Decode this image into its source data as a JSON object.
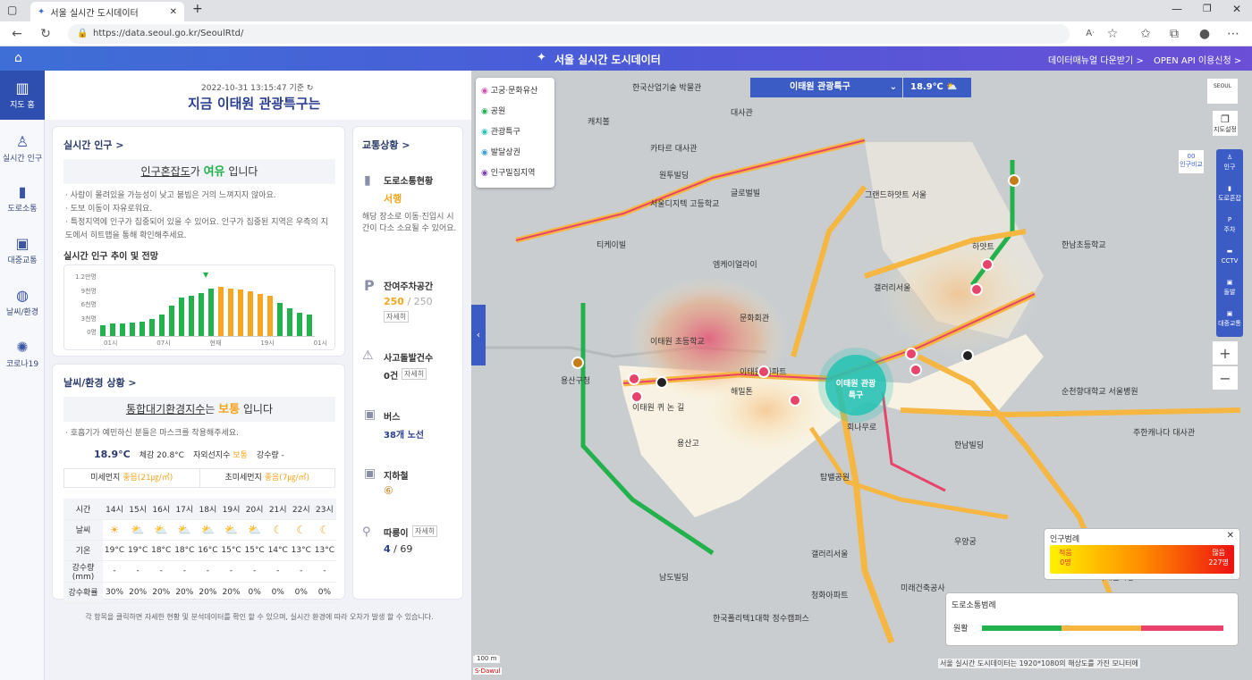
{
  "browser": {
    "tab_title": "서울 실시간 도시데이터",
    "url": "https://data.seoul.go.kr/SeoulRtd/"
  },
  "header": {
    "title": "서울 실시간 도시데이터",
    "link1": "데이터매뉴얼 다운받기 >",
    "link2": "OPEN API 이용신청 >"
  },
  "sidebar": {
    "items": [
      {
        "label": "지도 홈"
      },
      {
        "label": "실시간 인구"
      },
      {
        "label": "도로소통"
      },
      {
        "label": "대중교통"
      },
      {
        "label": "날씨/환경"
      },
      {
        "label": "코로나19"
      }
    ]
  },
  "panel": {
    "timestamp": "2022-10-31 13:15:47 기준",
    "heading": "지금 이태원 관광특구는",
    "pop": {
      "title": "실시간 인구 >",
      "status_pre": "인구혼잡도",
      "status_mid": "가 ",
      "status_val": "여유",
      "status_post": " 입니다",
      "desc1": "· 사람이 몰려있을 가능성이 낮고 붐빔은 거의 느껴지지 않아요.",
      "desc2": "· 도보 이동이 자유로워요.",
      "desc3": "· 특정지역에 인구가 집중되어 있을 수 있어요. 인구가 집중된 지역은 우측의 지도에서 히트맵을 통해 확인해주세요.",
      "trend_title": "실시간 인구 추이 및 전망",
      "yticks": [
        "1.2만명",
        "9천명",
        "6천명",
        "3천명",
        "0명"
      ],
      "xticks": [
        "01시",
        "07시",
        "현재",
        "19시",
        "01시"
      ]
    },
    "weather": {
      "title": "날씨/환경 상황 >",
      "status_pre": "통합대기환경지수",
      "status_mid": "는 ",
      "status_val": "보통",
      "status_post": " 입니다",
      "desc": "· 호흡기가 예민하신 분들은 마스크를 착용해주세요.",
      "temp": "18.9°C",
      "feels": "체감 20.8°C",
      "uv_label": "자외선지수",
      "uv_val": "보통",
      "rain_label": "강수량 -",
      "pm10_label": "미세먼지",
      "pm10_val": "좋음(21㎍/㎥)",
      "pm25_label": "초미세먼지",
      "pm25_val": "좋음(7㎍/㎥)",
      "row_labels": [
        "시간",
        "날씨",
        "기온",
        "강수량(mm)",
        "강수확률"
      ],
      "hours": [
        "14시",
        "15시",
        "16시",
        "17시",
        "18시",
        "19시",
        "20시",
        "21시",
        "22시",
        "23시"
      ],
      "temps": [
        "19°C",
        "19°C",
        "18°C",
        "18°C",
        "16°C",
        "15°C",
        "15°C",
        "14°C",
        "13°C",
        "13°C"
      ],
      "rain": [
        "-",
        "-",
        "-",
        "-",
        "-",
        "-",
        "-",
        "-",
        "-",
        "-"
      ],
      "prob": [
        "30%",
        "20%",
        "20%",
        "20%",
        "20%",
        "20%",
        "0%",
        "0%",
        "0%",
        "0%"
      ]
    },
    "traffic": {
      "title": "교통상황 >",
      "road_label": "도로소통현황",
      "road_val": "서행",
      "road_desc": "해당 장소로 이동·진입시 시간이 다소 소요될 수 있어요.",
      "park_label": "잔여주차공간",
      "park_val": "250",
      "park_total": "/ 250",
      "park_btn": "자세히",
      "acc_label": "사고돌발건수",
      "acc_val": "0건",
      "acc_btn": "자세히",
      "bus_label": "버스",
      "bus_val": "38개 노선",
      "sub_label": "지하철",
      "sub_val": "⑥",
      "bike_label": "따릉이",
      "bike_btn": "자세히",
      "bike_val": "4",
      "bike_total": "/ 69"
    },
    "footer": "각 항목을 클릭하면 자세한 현황 및 분석데이터를 확인 할 수 있으며, 실시간 환경에 따라 오차가 발생 할 수 있습니다."
  },
  "map": {
    "place_select": "이태원 관광특구",
    "temp": "18.9℃",
    "poi_legend": [
      "고궁·문화유산",
      "공원",
      "관광특구",
      "발달상권",
      "인구밀집지역"
    ],
    "pop_legend": {
      "title": "인구범례",
      "low": "적음",
      "low_val": "0명",
      "high": "많음",
      "high_val": "227명"
    },
    "road_legend": {
      "title": "도로소통범례",
      "smooth": "원활"
    },
    "buttons": [
      "지도설정",
      "인구비교",
      "인구",
      "도로혼잡",
      "주차",
      "CCTV",
      "돌발",
      "대중교통"
    ],
    "scale": "100 m",
    "center_label": "이태원 관광특구",
    "labels": [
      "한국산업기술 박물관",
      "캐치볼",
      "대사관",
      "카타르 대사관",
      "원투빌딩",
      "서울디지텍 고등학교",
      "글로벌빌",
      "그랜드하얏트 서울",
      "티케이빌",
      "엠케이얼라이",
      "갤러리서울",
      "하얏트",
      "한남초등학교",
      "이태원 초등학교",
      "이태원 아파트",
      "용산고",
      "용산구청",
      "문화회관",
      "해밀톤",
      "이태원 퀴 논 길",
      "이태원시장",
      "한국폴리텍1대학 정수캠퍼스",
      "남도빌딩",
      "갤러리서울",
      "주한캐나다 대사관",
      "청화아파트",
      "미래건축공사",
      "순천향대학교 서울병원",
      "한남빌딩",
      "우양궁",
      "탑밸공원",
      "회나무로"
    ],
    "attr": "서울 실시간 도시데이터는 1920*1080의 해상도를 가진 모니터에"
  }
}
